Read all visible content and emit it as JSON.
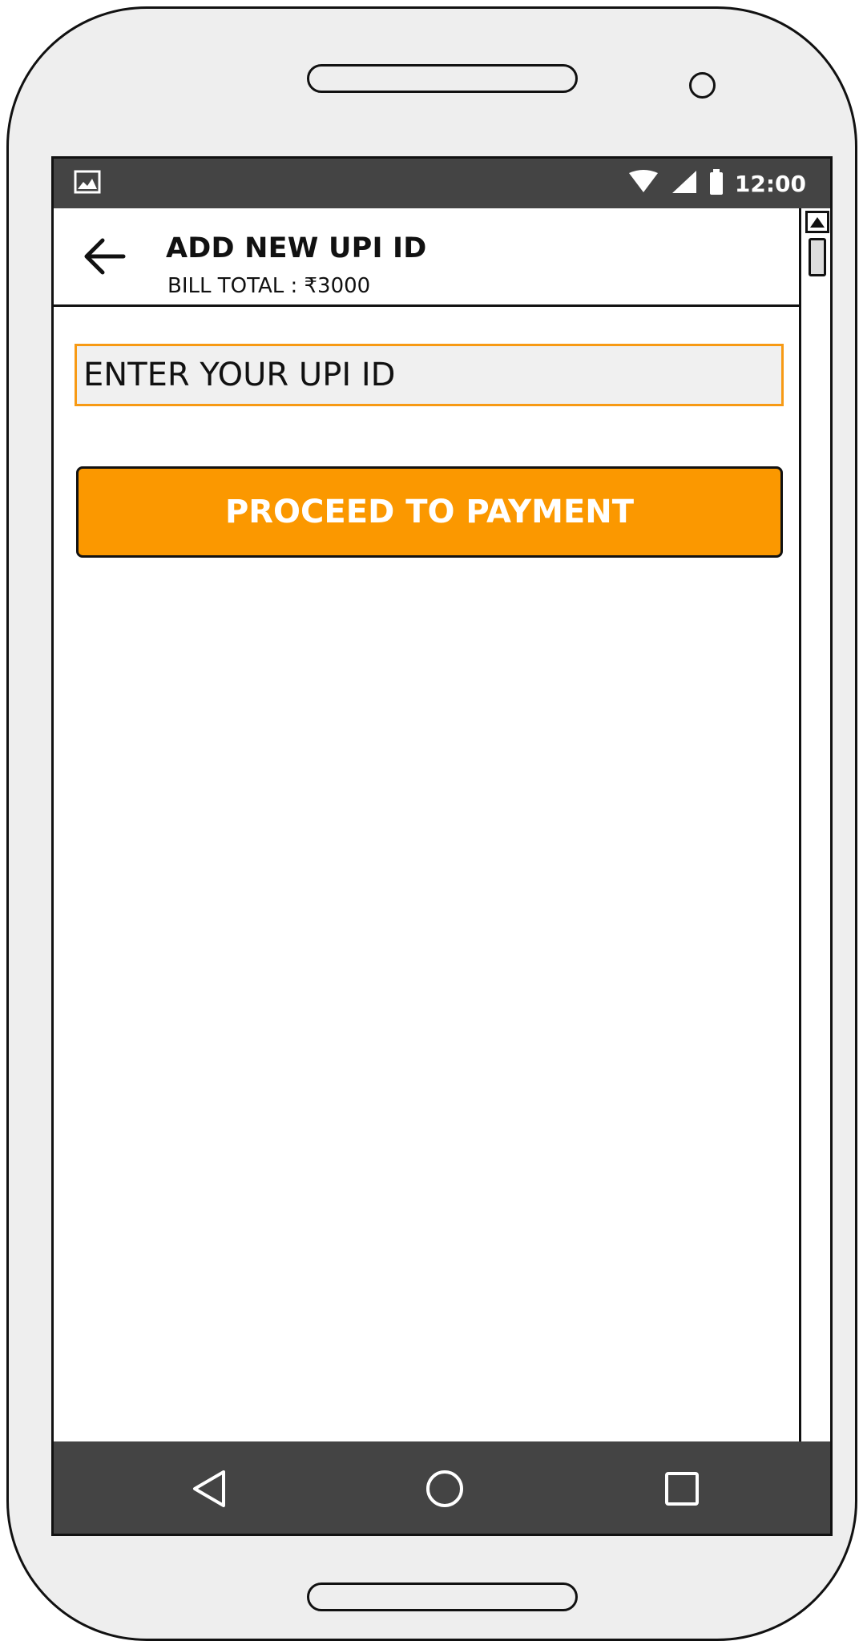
{
  "status_bar": {
    "time": "12:00",
    "icons": [
      "image-icon",
      "wifi-icon",
      "signal-icon",
      "battery-icon"
    ]
  },
  "header": {
    "title": "ADD NEW UPI ID",
    "subtitle": "BILL TOTAL : ₹3000",
    "back_icon": "arrow-left-icon"
  },
  "form": {
    "upi_input": {
      "placeholder": "ENTER YOUR UPI ID",
      "value": ""
    },
    "proceed_label": "PROCEED TO PAYMENT"
  },
  "nav_bar": {
    "icons": [
      "back-triangle-icon",
      "home-circle-icon",
      "recents-square-icon"
    ]
  },
  "colors": {
    "accent": "#fb9800",
    "input_border": "#f79a14",
    "bar_background": "#444444",
    "device_body": "#eeeeee"
  }
}
